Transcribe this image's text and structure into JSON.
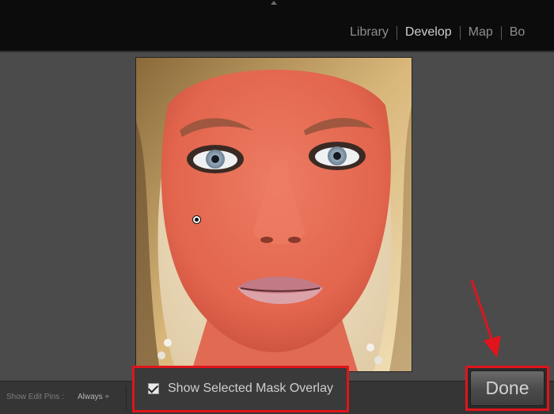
{
  "modules": [
    {
      "label": "Library",
      "active": false
    },
    {
      "label": "Develop",
      "active": true
    },
    {
      "label": "Map",
      "active": false
    },
    {
      "label": "Bo",
      "active": false
    }
  ],
  "toolbar": {
    "edit_pins_label": "Show Edit Pins :",
    "edit_pins_value": "Always ÷",
    "mask_overlay_label": "Show Selected Mask Overlay",
    "mask_overlay_checked": true,
    "done_label": "Done"
  },
  "colors": {
    "mask_overlay": "#e5614a",
    "highlight_box": "#e0141c",
    "panel_bg": "#4b4b4b",
    "topbar_bg": "#0c0c0c"
  },
  "icons": [
    "collapse-arrow-icon",
    "edit-pin-icon",
    "check-icon"
  ]
}
